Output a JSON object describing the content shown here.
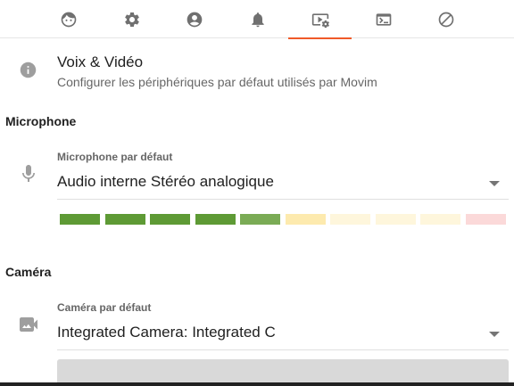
{
  "tabs": [
    {
      "icon": "face-icon",
      "active": false
    },
    {
      "icon": "gear-icon",
      "active": false
    },
    {
      "icon": "account-icon",
      "active": false
    },
    {
      "icon": "bell-icon",
      "active": false
    },
    {
      "icon": "video-settings-icon",
      "active": true
    },
    {
      "icon": "terminal-icon",
      "active": false
    },
    {
      "icon": "block-icon",
      "active": false
    }
  ],
  "header": {
    "icon": "info-icon",
    "title": "Voix & Vidéo",
    "subtitle": "Configurer les périphériques par défaut utilisés par Movim"
  },
  "microphone": {
    "section_title": "Microphone",
    "icon": "microphone-icon",
    "label": "Microphone par défaut",
    "value": "Audio interne Stéréo analogique",
    "level_meter": {
      "segments": 10,
      "active_segments": 5,
      "colors": [
        "#5e9a35",
        "#5e9a35",
        "#5e9a35",
        "#5e9a35",
        "#7aab55",
        "#fdeaae",
        "#fef6dc",
        "#fef6dc",
        "#fef6dc",
        "#fbd9d9"
      ]
    }
  },
  "camera": {
    "section_title": "Caméra",
    "icon": "camera-icon",
    "label": "Caméra par défaut",
    "value": "Integrated Camera: Integrated C"
  },
  "colors": {
    "accent": "#f05a28",
    "icon": "#707070",
    "muted_icon": "#9e9e9e"
  }
}
